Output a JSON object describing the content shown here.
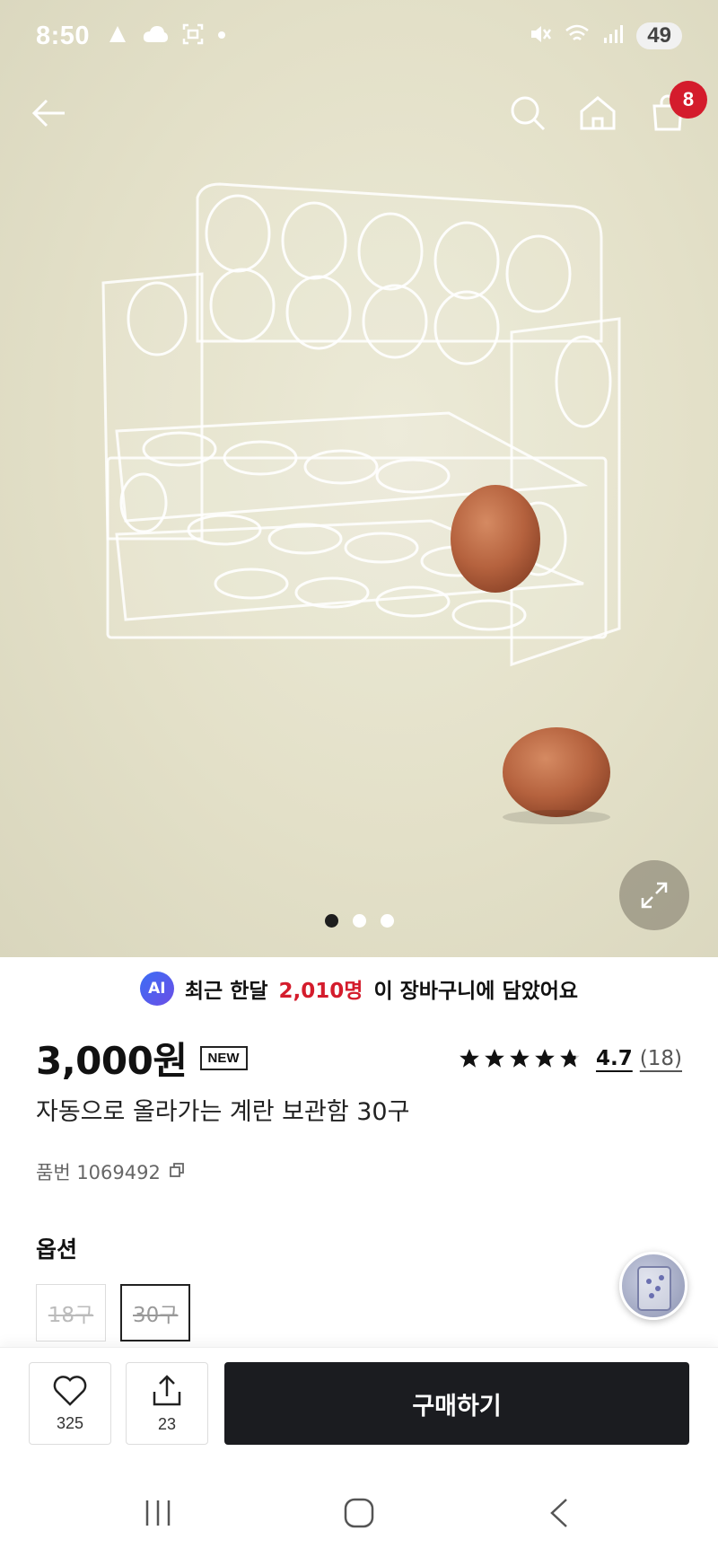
{
  "status_bar": {
    "time": "8:50",
    "battery": "49",
    "icons_left": [
      "app-notification-icon",
      "cloud-icon",
      "screenshot-icon",
      "dot-icon"
    ],
    "icons_right": [
      "mute-icon",
      "wifi-icon",
      "signal-icon"
    ]
  },
  "nav": {
    "cart_badge": "8",
    "icons": [
      "back-arrow-icon",
      "search-icon",
      "home-icon",
      "cart-icon"
    ]
  },
  "carousel": {
    "total_dots": 3,
    "active_index": 0
  },
  "ai_banner": {
    "badge": "AI",
    "prefix": "최근 한달",
    "count": "2,010명",
    "suffix": "이 장바구니에 담았어요"
  },
  "product": {
    "price": "3,000원",
    "new_badge": "NEW",
    "rating": "4.7",
    "review_count": "(18)",
    "stars": 4.7,
    "name": "자동으로 올라가는 계란 보관함 30구",
    "sku": "품번 1069492"
  },
  "options": {
    "title": "옵션",
    "items": [
      {
        "label": "18구",
        "selected": false,
        "sold_out": true
      },
      {
        "label": "30구",
        "selected": true,
        "sold_out": true
      }
    ]
  },
  "actions": {
    "like_count": "325",
    "share_count": "23",
    "buy_label": "구매하기"
  },
  "colors": {
    "accent_red": "#d41c2c",
    "buy_button": "#1b1c20",
    "hero_bg": "#e5e2ca"
  }
}
